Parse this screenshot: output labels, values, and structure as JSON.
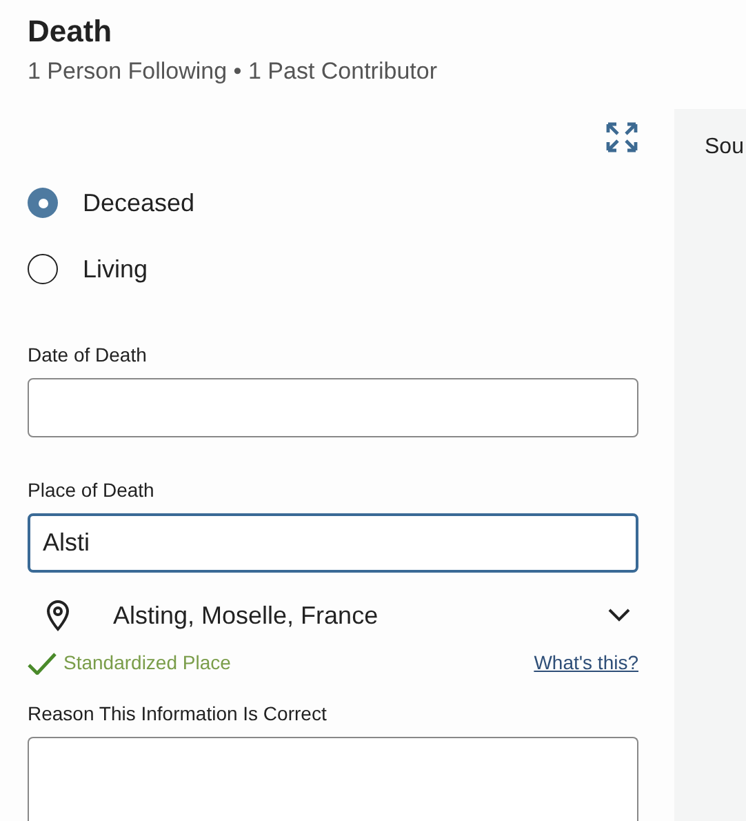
{
  "header": {
    "title": "Death",
    "subtitle": "1 Person Following • 1 Past Contributor"
  },
  "status_options": [
    {
      "label": "Deceased",
      "selected": true
    },
    {
      "label": "Living",
      "selected": false
    }
  ],
  "date_field": {
    "label": "Date of Death"
  },
  "place_field": {
    "label": "Place of Death",
    "value": "Alsti",
    "focused": true
  },
  "place_suggestion": {
    "text": "Alsting, Moselle, France"
  },
  "standardized": {
    "text": "Standardized Place",
    "link": "What's this?"
  },
  "reason_field": {
    "label": "Reason This Information Is Correct"
  },
  "side_panel": {
    "heading": "Sou"
  }
}
